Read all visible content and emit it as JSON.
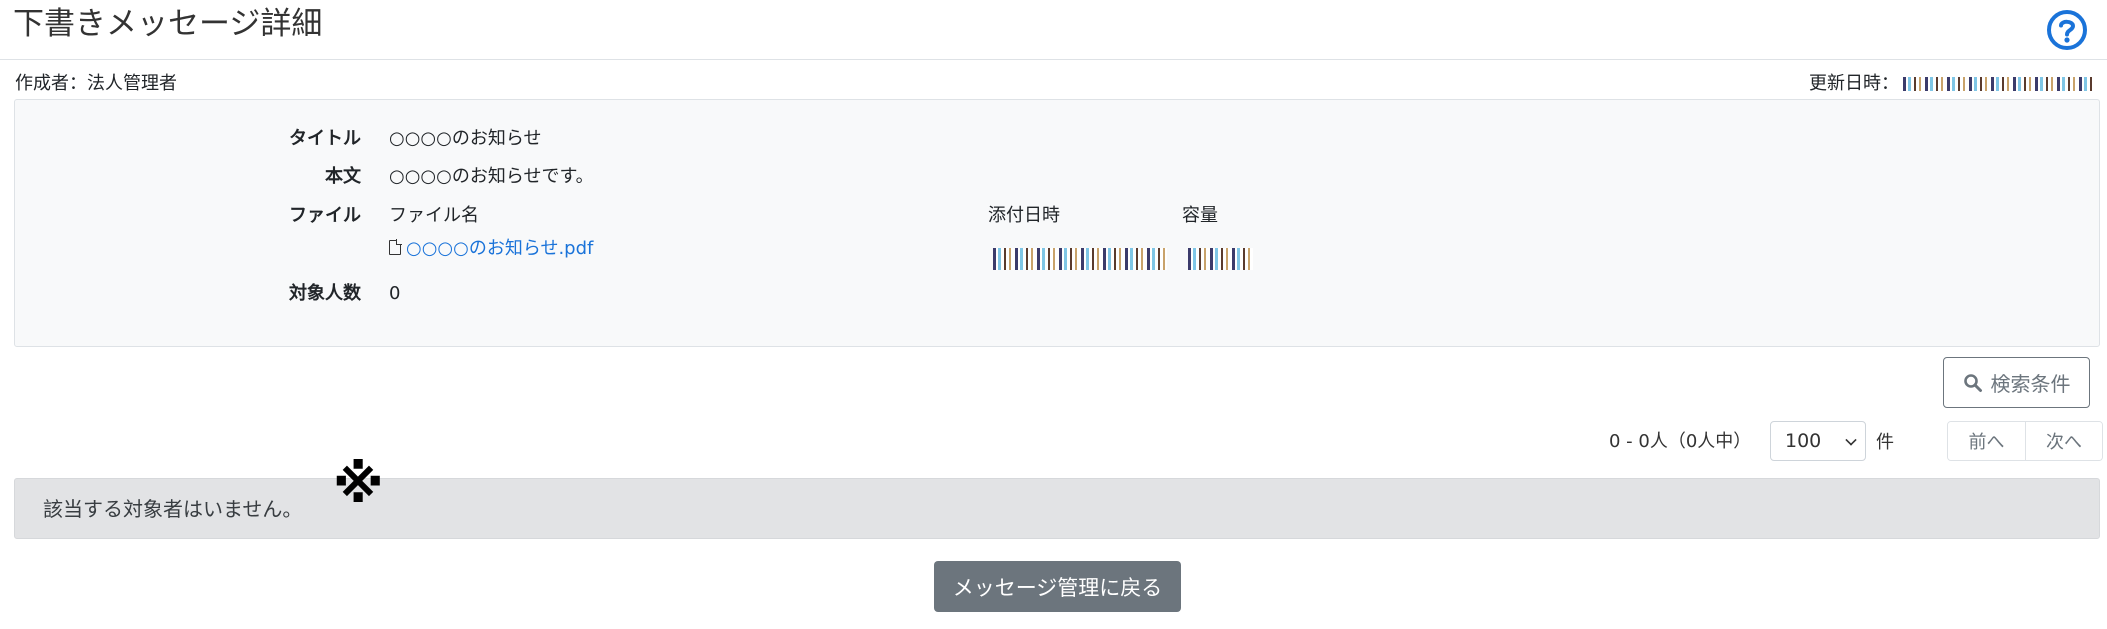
{
  "header": {
    "title": "下書きメッセージ詳細",
    "help_icon": "question-circle-icon",
    "accent_color": "#1a73d9"
  },
  "meta": {
    "creator_label": "作成者：法人管理者",
    "updated_label": "更新日時："
  },
  "detail": {
    "title_label": "タイトル",
    "title_value": "○○○○のお知らせ",
    "body_label": "本文",
    "body_value": "○○○○のお知らせです。",
    "file_label": "ファイル",
    "file_columns": {
      "name": "ファイル名",
      "attached_at": "添付日時",
      "size": "容量"
    },
    "file_name": "○○○○のお知らせ.pdf",
    "targets_label": "対象人数",
    "targets_value": "0"
  },
  "search_button_label": "検索条件",
  "pagination": {
    "count_text": "0 - 0人（0人中）",
    "per_page_selected": "100",
    "unit_label": "件",
    "prev_label": "前へ",
    "next_label": "次へ"
  },
  "empty_message": "該当する対象者はいません。",
  "annotation_mark": "※",
  "back_button_label": "メッセージ管理に戻る"
}
